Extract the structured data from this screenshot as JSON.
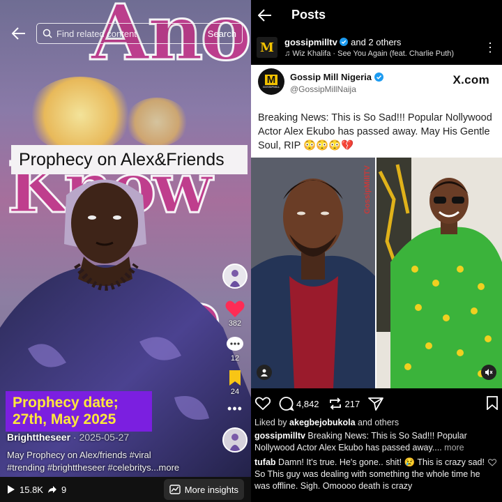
{
  "left": {
    "bg_text_top": "Ano",
    "bg_text_mid": "Know",
    "bg_text_low": "o",
    "search": {
      "placeholder": "Find related content",
      "button": "Search"
    },
    "banner": "Prophecy on Alex&Friends",
    "rail": {
      "likes": "382",
      "comments": "12",
      "saves": "24"
    },
    "overlay_box": {
      "line1": "Prophecy date;",
      "line2": "27th, May 2025"
    },
    "author": "Brighttheseer",
    "date": "· 2025-05-27",
    "description_line1": "May Prophecy on Alex/friends #viral",
    "description_line2": "#trending #brighttheseer #celebritys...more",
    "bottom": {
      "views": "15.8K",
      "shares": "9",
      "insights": "More insights"
    }
  },
  "right": {
    "header_title": "Posts",
    "post_account": "gossipmilltv",
    "post_others": "and 2 others",
    "music": "Wiz Khalifa · See You Again (feat. Charlie Puth)",
    "mm_logo": "M",
    "tweet": {
      "name": "Gossip Mill Nigeria",
      "handle": "@GossipMillNaija",
      "x_label": "X.com",
      "logo_text": "GOSSIPMILL",
      "body": "Breaking News: This is So Sad!!! Popular Nollywood Actor Alex Ekubo has passed away. May His Gentle Soul, RIP 😳😳😳💔"
    },
    "watermark": "GossipMillTV",
    "actions": {
      "comments": "4,842",
      "reposts": "217"
    },
    "liked_prefix": "Liked by",
    "liked_user": "akegbejobukola",
    "liked_suffix": "and others",
    "caption_user": "gossipmilltv",
    "caption_text": "Breaking News: This is So Sad!!! Popular Nollywood Actor Alex Ekubo has passed away....",
    "caption_more": "more",
    "comment_user": "tufab",
    "comment_text": "Damn! It's true. He's gone.. shit! 😢 This is crazy sad! So This guy was dealing with something the whole time he was offline. Sigh.  Omoooo death is crazy"
  },
  "colors": {
    "tiktok_heart": "#fe2c55",
    "overlay_purple": "#7b1fe0",
    "overlay_yellow": "#ffe83a",
    "verified_blue": "#1d9bf0",
    "shirt_green": "#3bb33b"
  }
}
